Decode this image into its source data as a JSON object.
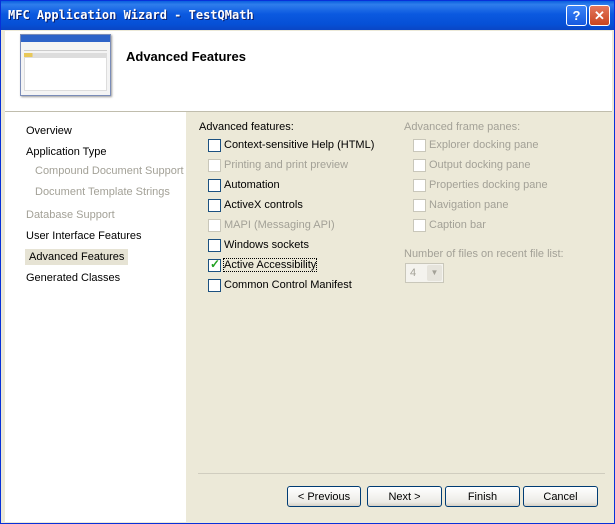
{
  "window": {
    "title": "MFC Application Wizard - TestQMath",
    "help_glyph": "?",
    "close_glyph": "✕"
  },
  "header": {
    "title": "Advanced Features"
  },
  "sidebar": {
    "items": [
      {
        "label": "Overview",
        "state": "normal"
      },
      {
        "label": "Application Type",
        "state": "normal"
      },
      {
        "label": "Compound Document Support",
        "state": "disabled"
      },
      {
        "label": "Document Template Strings",
        "state": "disabled"
      },
      {
        "label": "Database Support",
        "state": "disabled"
      },
      {
        "label": "User Interface Features",
        "state": "normal"
      },
      {
        "label": "Advanced Features",
        "state": "selected"
      },
      {
        "label": "Generated Classes",
        "state": "normal"
      }
    ]
  },
  "advanced": {
    "heading": "Advanced features:",
    "options": [
      {
        "label": "Context-sensitive Help (HTML)",
        "checked": false,
        "enabled": true
      },
      {
        "label": "Printing and print preview",
        "checked": false,
        "enabled": false
      },
      {
        "label": "Automation",
        "checked": false,
        "enabled": true
      },
      {
        "label": "ActiveX controls",
        "checked": false,
        "enabled": true
      },
      {
        "label": "MAPI (Messaging API)",
        "checked": false,
        "enabled": false
      },
      {
        "label": "Windows sockets",
        "checked": false,
        "enabled": true
      },
      {
        "label": "Active Accessibility",
        "checked": true,
        "enabled": true
      },
      {
        "label": "Common Control Manifest",
        "checked": false,
        "enabled": true
      }
    ]
  },
  "frame_panes": {
    "heading": "Advanced frame panes:",
    "options": [
      {
        "label": "Explorer docking pane",
        "checked": false,
        "enabled": false
      },
      {
        "label": "Output docking pane",
        "checked": false,
        "enabled": false
      },
      {
        "label": "Properties docking pane",
        "checked": false,
        "enabled": false
      },
      {
        "label": "Navigation pane",
        "checked": false,
        "enabled": false
      },
      {
        "label": "Caption bar",
        "checked": false,
        "enabled": false
      }
    ]
  },
  "recent_files": {
    "label": "Number of files on recent file list:",
    "value": "4",
    "enabled": false
  },
  "buttons": {
    "previous": "< Previous",
    "next": "Next >",
    "finish": "Finish",
    "cancel": "Cancel"
  }
}
